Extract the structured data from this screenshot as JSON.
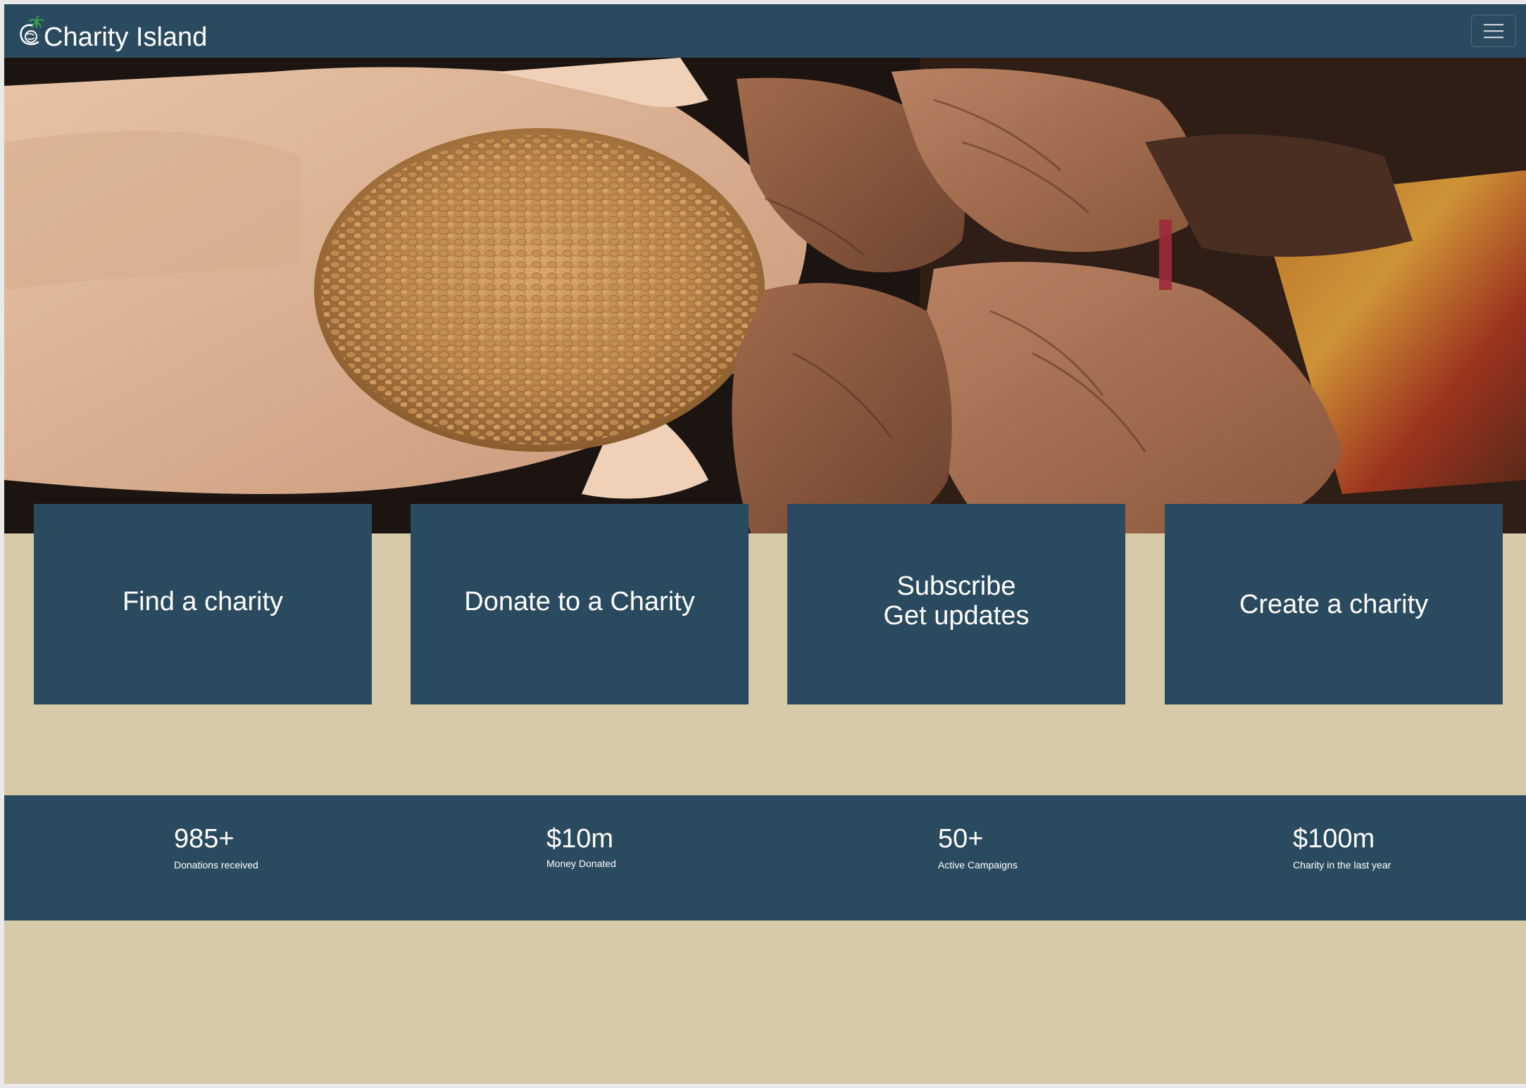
{
  "navbar": {
    "brand": "Charity Island",
    "logo_icon": "globe-palm-logo",
    "menu_icon": "hamburger-menu-icon"
  },
  "hero": {
    "image": "hands-holding-wheat-grain-photo"
  },
  "actions": [
    {
      "label_lines": [
        "Find a charity"
      ]
    },
    {
      "label_lines": [
        "Donate to a Charity"
      ]
    },
    {
      "label_lines": [
        "Subscribe",
        "Get updates"
      ]
    },
    {
      "label_lines": [
        "Create a charity"
      ]
    }
  ],
  "stats": [
    {
      "value": "985+",
      "label": "Donations received"
    },
    {
      "value": "$10m",
      "label": "Money Donated"
    },
    {
      "value": "50+",
      "label": "Active Campaigns"
    },
    {
      "value": "$100m",
      "label": "Charity in the last year"
    }
  ],
  "colors": {
    "navy": "#2a4a5f",
    "sand": "#d7caa9",
    "text": "#ffffff",
    "logo_green": "#3aa54a"
  }
}
